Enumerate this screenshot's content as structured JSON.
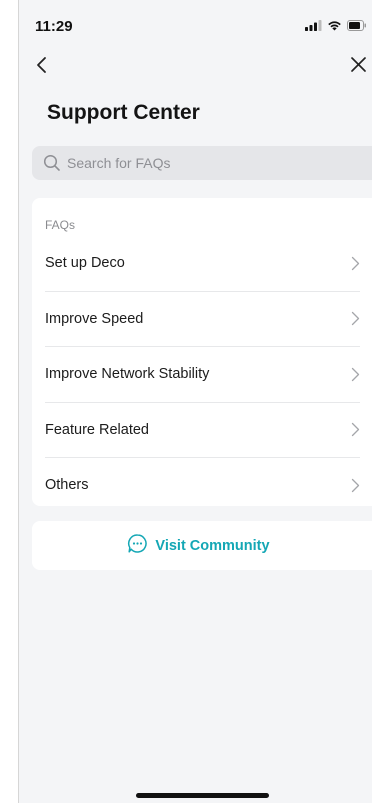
{
  "status_bar": {
    "time": "11:29",
    "icons": [
      "signal-icon",
      "wifi-icon",
      "battery-icon"
    ]
  },
  "nav": {
    "back_icon": "chevron-left-icon",
    "close_icon": "close-icon"
  },
  "page": {
    "title": "Support Center"
  },
  "search": {
    "placeholder": "Search for FAQs",
    "value": "",
    "icon": "search-icon"
  },
  "faqs": {
    "header": "FAQs",
    "items": [
      {
        "label": "Set up Deco"
      },
      {
        "label": "Improve Speed"
      },
      {
        "label": "Improve Network Stability"
      },
      {
        "label": "Feature Related"
      },
      {
        "label": "Others"
      }
    ]
  },
  "community": {
    "label": "Visit Community",
    "icon": "chat-bubble-icon"
  },
  "colors": {
    "accent": "#14a7b5",
    "background": "#f4f5f7",
    "card": "#ffffff",
    "search_bg": "#e5e6e9"
  }
}
